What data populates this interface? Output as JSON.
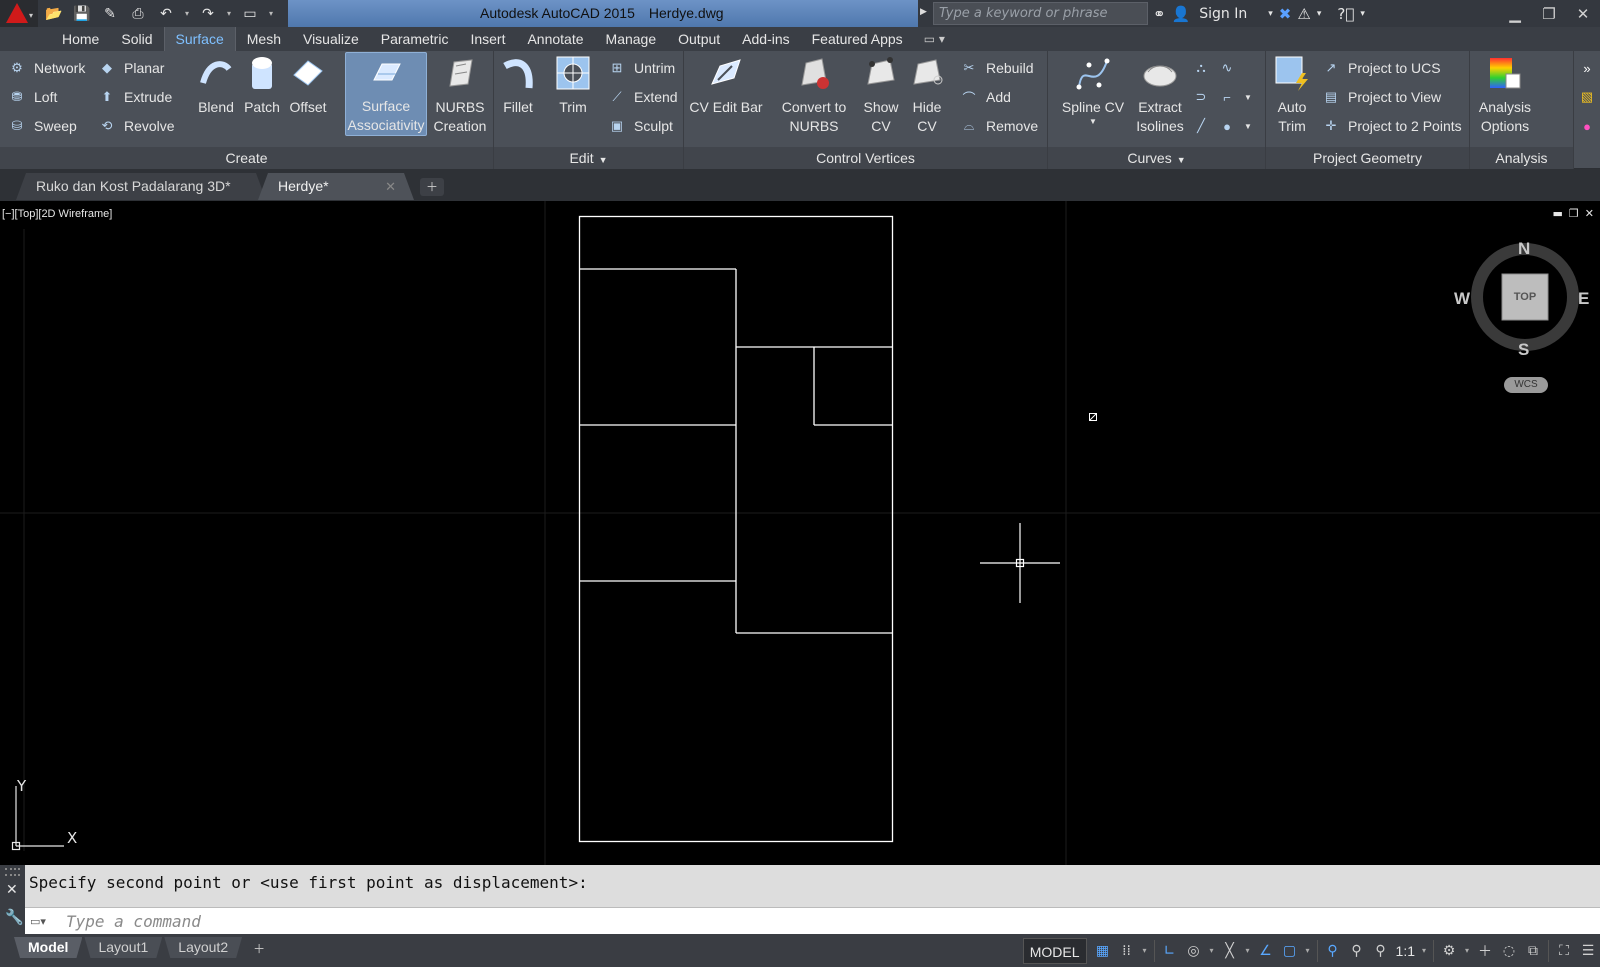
{
  "titlebar": {
    "app_name": "Autodesk AutoCAD 2015",
    "file_name": "Herdye.dwg",
    "search_placeholder": "Type a keyword or phrase",
    "signin": "Sign In",
    "qat_icons": [
      "open-icon",
      "save-icon",
      "save-as-icon",
      "print-icon",
      "undo-icon",
      "redo-icon",
      "share-icon"
    ],
    "window_controls": [
      "minimize-icon",
      "restore-icon",
      "close-icon"
    ]
  },
  "ribbon_tabs": [
    "Home",
    "Solid",
    "Surface",
    "Mesh",
    "Visualize",
    "Parametric",
    "Insert",
    "Annotate",
    "Manage",
    "Output",
    "Add-ins",
    "Featured Apps"
  ],
  "active_tab": "Surface",
  "panels": {
    "create": {
      "title": "Create",
      "small_left": [
        "Network",
        "Loft",
        "Sweep"
      ],
      "small_right": [
        "Planar",
        "Extrude",
        "Revolve"
      ],
      "big": [
        "Blend",
        "Patch",
        "Offset"
      ],
      "surface_assoc_line1": "Surface",
      "surface_assoc_line2": "Associativity",
      "nurbs_line1": "NURBS",
      "nurbs_line2": "Creation"
    },
    "edit": {
      "title": "Edit",
      "fillet": "Fillet",
      "trim": "Trim",
      "small": [
        "Untrim",
        "Extend",
        "Sculpt"
      ]
    },
    "cv": {
      "title": "Control Vertices",
      "cv_edit_bar": "CV Edit Bar",
      "convert_line1": "Convert to",
      "convert_line2": "NURBS",
      "show_line1": "Show",
      "show_line2": "CV",
      "hide_line1": "Hide",
      "hide_line2": "CV",
      "small": [
        "Rebuild",
        "Add",
        "Remove"
      ]
    },
    "curves": {
      "title": "Curves",
      "spline_cv": "Spline CV",
      "extract_line1": "Extract",
      "extract_line2": "Isolines"
    },
    "project": {
      "title": "Project Geometry",
      "auto_line1": "Auto",
      "auto_line2": "Trim",
      "small": [
        "Project to UCS",
        "Project to View",
        "Project to 2 Points"
      ]
    },
    "analysis": {
      "title": "Analysis",
      "options_line1": "Analysis",
      "options_line2": "Options"
    }
  },
  "file_tabs": [
    "Ruko dan Kost Padalarang 3D*",
    "Herdye*"
  ],
  "active_file_tab": "Herdye*",
  "viewport": {
    "label": "[−][Top][2D Wireframe]",
    "viewcube": {
      "n": "N",
      "s": "S",
      "e": "E",
      "w": "W",
      "face": "TOP",
      "wcs": "WCS"
    },
    "ucs_x": "X",
    "ucs_y": "Y"
  },
  "command": {
    "history": "Specify second point or <use first point as displacement>:",
    "placeholder": "Type a command"
  },
  "layout_tabs": [
    "Model",
    "Layout1",
    "Layout2"
  ],
  "active_layout": "Model",
  "status": {
    "model": "MODEL",
    "scale": "1:1"
  },
  "colors": {
    "accent": "#7fc0ff",
    "title_band": "#5b84bb",
    "drawing_lines": "#ffffff",
    "viewport_bg": "#000000"
  }
}
